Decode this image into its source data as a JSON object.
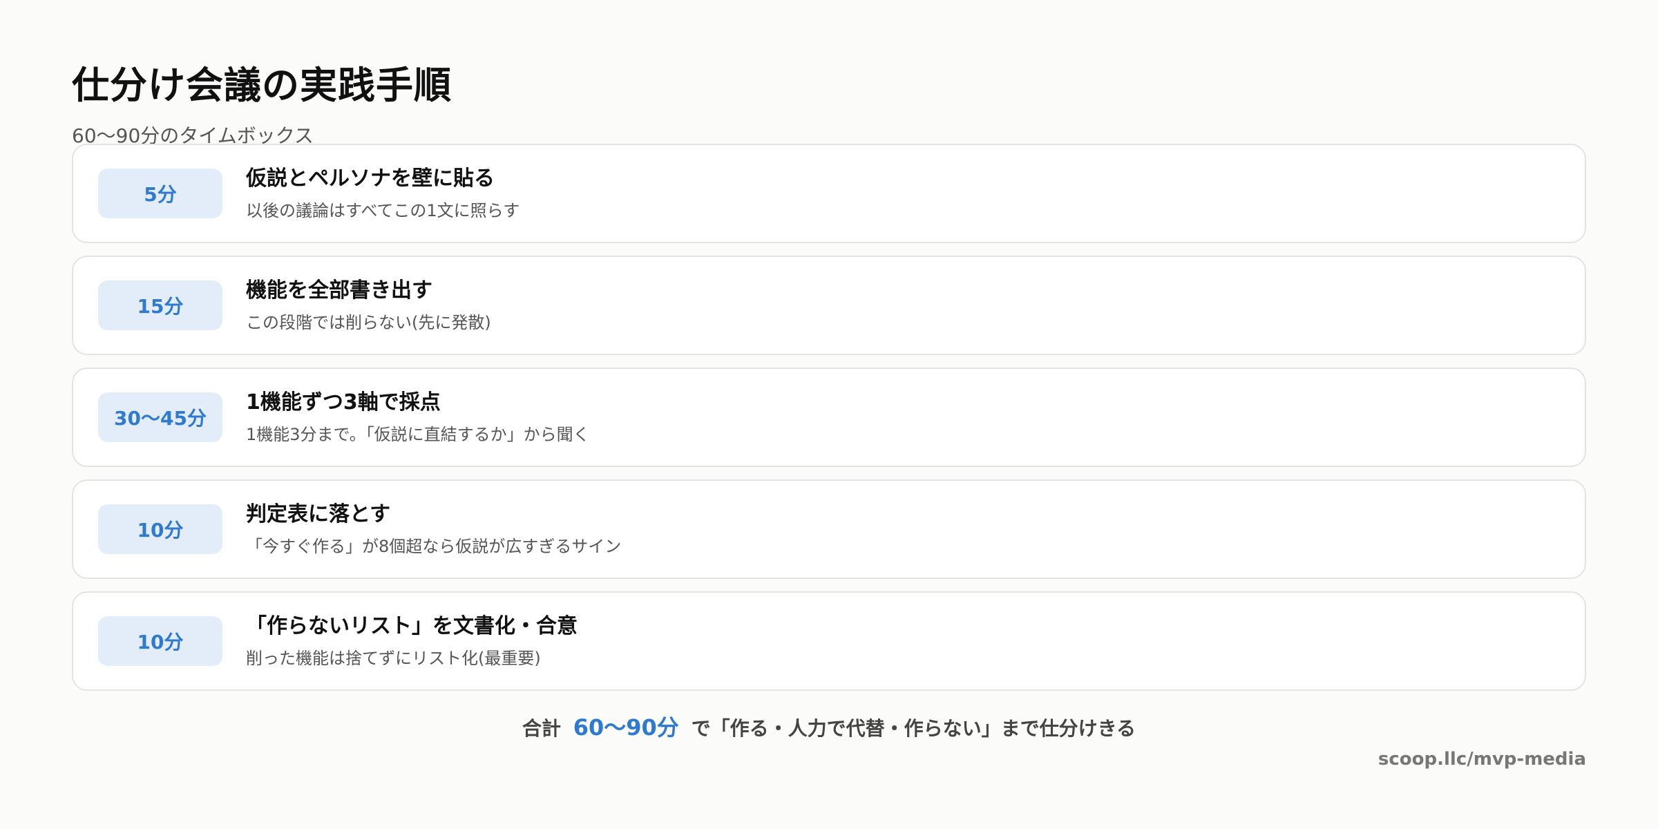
{
  "page": {
    "title": "仕分け会議の実践手順",
    "subtitle": "60〜90分のタイムボックス"
  },
  "steps": [
    {
      "time": "5分",
      "title": "仮説とペルソナを壁に貼る",
      "description": "以後の議論はすべてこの1文に照らす"
    },
    {
      "time": "15分",
      "title": "機能を全部書き出す",
      "description": "この段階では削らない(先に発散)"
    },
    {
      "time": "30〜45分",
      "title": "1機能ずつ3軸で採点",
      "description": "1機能3分まで。「仮説に直結するか」から聞く"
    },
    {
      "time": "10分",
      "title": "判定表に落とす",
      "description": "「今すぐ作る」が8個超なら仮説が広すぎるサイン"
    },
    {
      "time": "10分",
      "title": "「作らないリスト」を文書化・合意",
      "description": "削った機能は捨てずにリスト化(最重要)"
    }
  ],
  "summary": {
    "prefix": "合計",
    "highlight": "60〜90分",
    "suffix": "で「作る・人力で代替・作らない」まで仕分けきる"
  },
  "footer": {
    "source": "scoop.llc/mvp-media"
  },
  "colors": {
    "accent": "#2f7ad1",
    "badge_background": "#e3edf9",
    "page_background": "#fbfbf9"
  }
}
